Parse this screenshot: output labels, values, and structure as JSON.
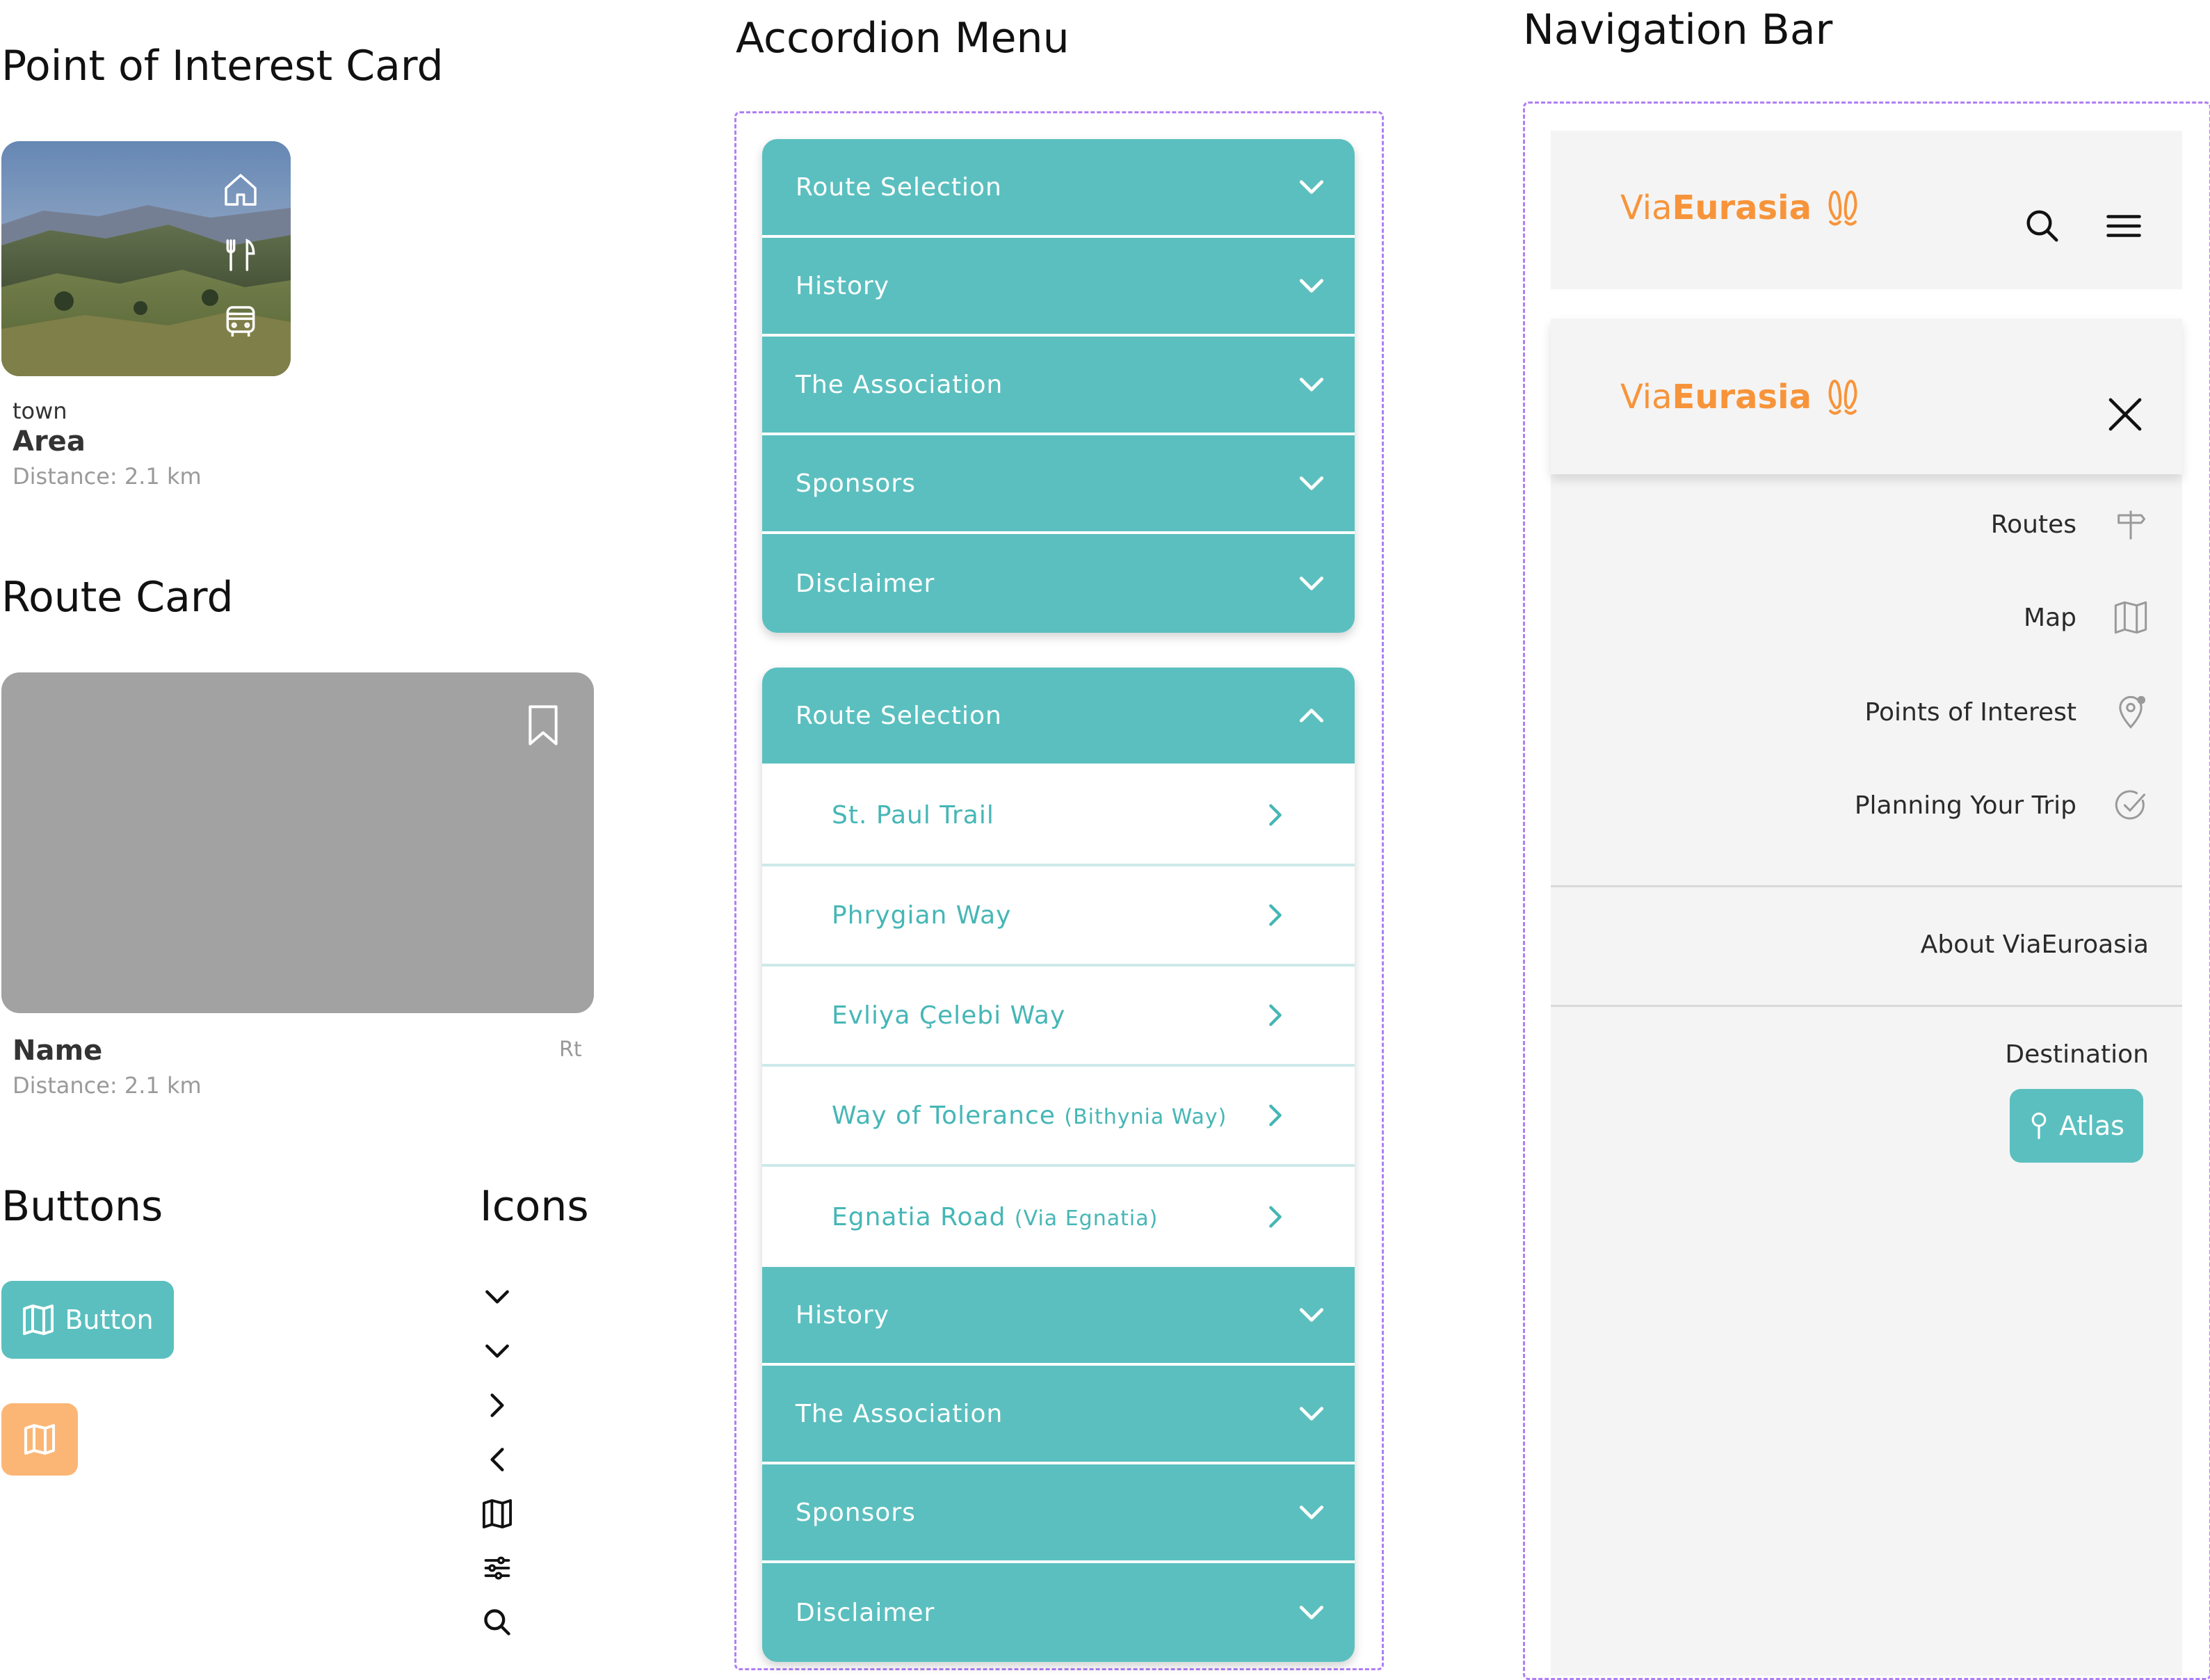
{
  "sections": {
    "poi_title": "Point of Interest Card",
    "route_title": "Route Card",
    "buttons_title": "Buttons",
    "icons_title": "Icons",
    "accordion_title": "Accordion Menu",
    "nav_title": "Navigation Bar"
  },
  "poi_card": {
    "type": "town",
    "name": "Area",
    "distance": "Distance: 2.1 km",
    "icons": [
      "home-icon",
      "restaurant-icon",
      "bus-icon"
    ]
  },
  "route_card": {
    "name": "Name",
    "distance": "Distance: 2.1 km",
    "tag": "Rt",
    "icon": "bookmark-icon"
  },
  "buttons": {
    "primary_label": "Button",
    "primary_icon": "map-icon",
    "square_icon": "map-icon"
  },
  "icons_list": [
    "chevron-down-icon",
    "chevron-down-icon",
    "chevron-right-icon",
    "chevron-left-icon",
    "map-icon",
    "sliders-icon",
    "search-icon"
  ],
  "accordion_collapsed": [
    "Route Selection",
    "History",
    "The Association",
    "Sponsors",
    "Disclaimer"
  ],
  "accordion_expanded": {
    "open_item": "Route Selection",
    "sub_items": [
      {
        "label": "St. Paul Trail",
        "small": ""
      },
      {
        "label": "Phrygian Way",
        "small": ""
      },
      {
        "label": "Evliya Çelebi Way",
        "small": ""
      },
      {
        "label": "Way of Tolerance",
        "small": "(Bithynia Way)"
      },
      {
        "label": "Egnatia Road",
        "small": "(Via Egnatia)"
      }
    ],
    "rest": [
      "History",
      "The Association",
      "Sponsors",
      "Disclaimer"
    ]
  },
  "nav": {
    "logo_via": "Via",
    "logo_eurasia": "Eurasia",
    "menu_items": [
      {
        "label": "Routes",
        "icon": "signpost-icon"
      },
      {
        "label": "Map",
        "icon": "map-icon"
      },
      {
        "label": "Points of Interest",
        "icon": "location-pin-icon"
      },
      {
        "label": "Planning Your Trip",
        "icon": "check-circle-icon"
      }
    ],
    "about": "About ViaEuroasia",
    "destination_label": "Destination",
    "destination_button": "Atlas"
  },
  "colors": {
    "teal": "#5bbfbf",
    "teal_text": "#46b6b6",
    "orange": "#f7943a",
    "orange_button": "#fbb675",
    "frame": "#b07ef5",
    "panel": "#f4f4f4"
  }
}
